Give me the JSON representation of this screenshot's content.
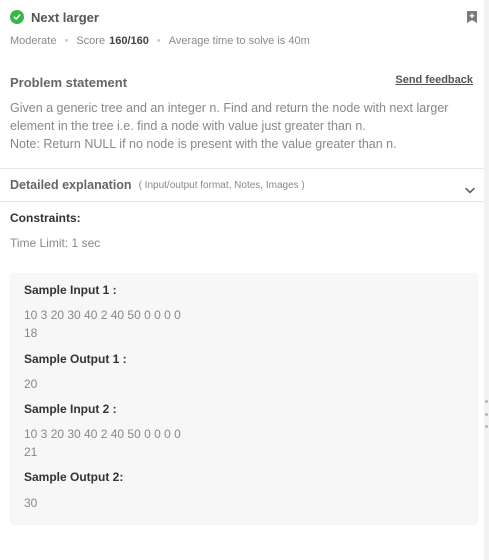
{
  "problem": {
    "title": "Next larger",
    "difficulty": "Moderate",
    "score_label": "Score",
    "score_value": "160/160",
    "avg_time": "Average time to solve is 40m"
  },
  "statement": {
    "heading": "Problem statement",
    "feedback_link": "Send feedback",
    "lines": [
      "Given a generic tree and an integer n. Find and return the node with next larger",
      "element in the tree i.e. find a node with value just greater than n.",
      "Note: Return NULL if no node is present with the value greater than n."
    ]
  },
  "details": {
    "title": "Detailed explanation",
    "subtitle": "( Input/output format, Notes, Images )"
  },
  "constraints": {
    "heading": "Constraints:",
    "text": "Time Limit: 1 sec"
  },
  "samples": [
    {
      "label": "Sample Input 1 :",
      "lines": [
        "10 3 20 30 40 2 40 50 0 0 0 0",
        "18"
      ]
    },
    {
      "label": "Sample Output 1 :",
      "lines": [
        "20"
      ]
    },
    {
      "label": "Sample Input 2 :",
      "lines": [
        "10 3 20 30 40 2 40 50 0 0 0 0",
        "21"
      ]
    },
    {
      "label": "Sample Output 2:",
      "lines": [
        "30"
      ]
    }
  ],
  "colors": {
    "success_green": "#39b54a",
    "sample_bg": "#f7f7f7"
  },
  "icons": [
    "check-circle-icon",
    "bookmark-add-icon",
    "chevron-down-icon"
  ]
}
